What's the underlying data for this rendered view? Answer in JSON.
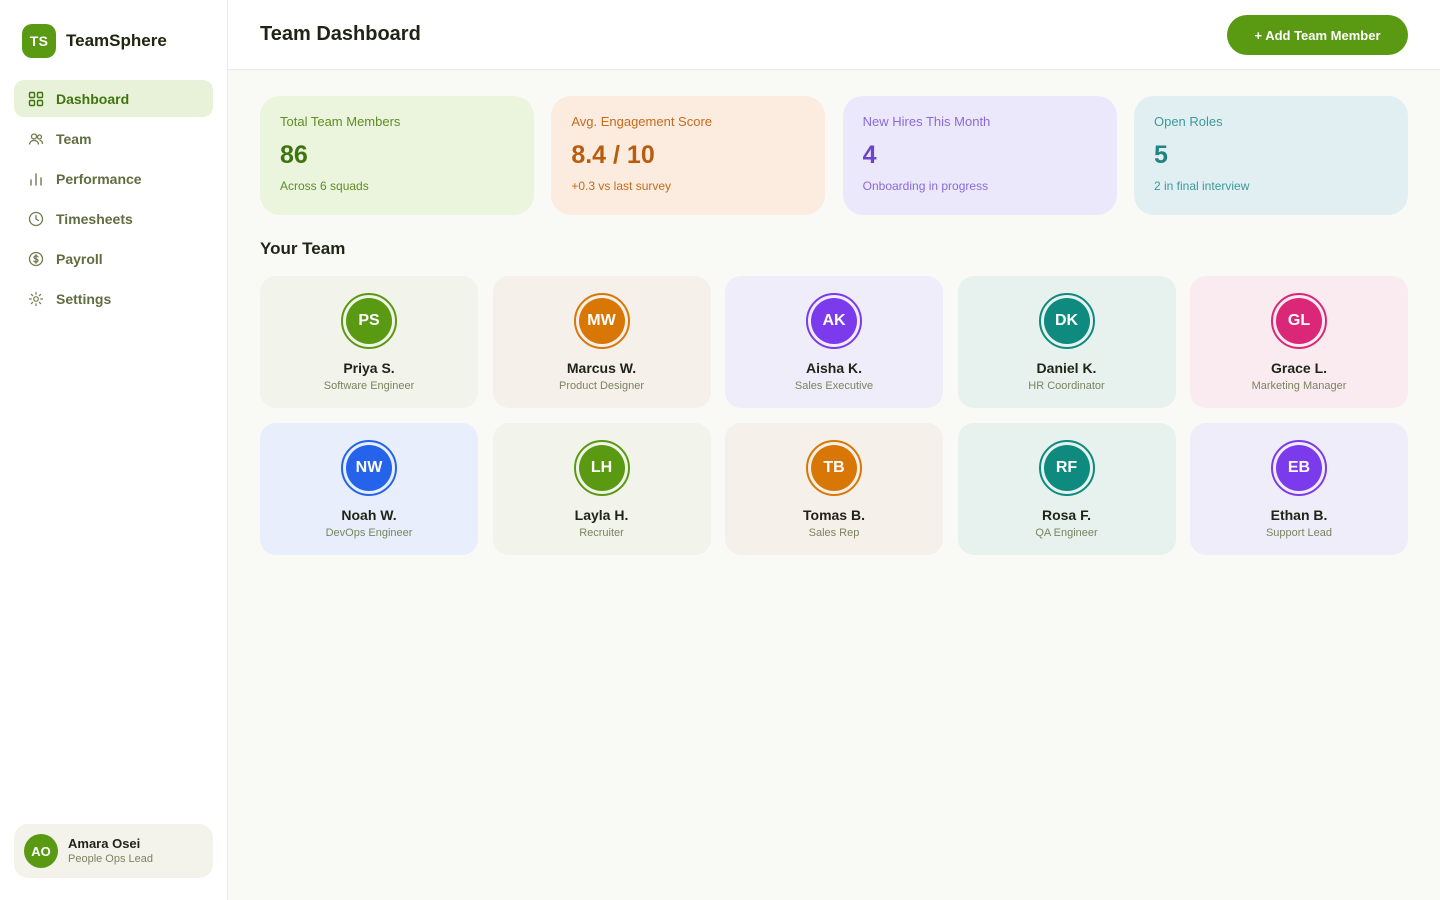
{
  "brand": {
    "initials": "TS",
    "name": "TeamSphere"
  },
  "nav": [
    {
      "label": "Dashboard",
      "icon": "grid-icon",
      "active": true
    },
    {
      "label": "Team",
      "icon": "users-icon",
      "active": false
    },
    {
      "label": "Performance",
      "icon": "bar-chart-icon",
      "active": false
    },
    {
      "label": "Timesheets",
      "icon": "clock-icon",
      "active": false
    },
    {
      "label": "Payroll",
      "icon": "dollar-icon",
      "active": false
    },
    {
      "label": "Settings",
      "icon": "gear-icon",
      "active": false
    }
  ],
  "user": {
    "initials": "AO",
    "name": "Amara Osei",
    "role": "People Ops Lead"
  },
  "header": {
    "title": "Team Dashboard",
    "add_button": "+ Add Team Member"
  },
  "stats": [
    {
      "label": "Total Team Members",
      "value": "86",
      "sub": "Across 6 squads",
      "theme": "green"
    },
    {
      "label": "Avg. Engagement Score",
      "value": "8.4 / 10",
      "sub": "+0.3 vs last survey",
      "theme": "orange"
    },
    {
      "label": "New Hires This Month",
      "value": "4",
      "sub": "Onboarding in progress",
      "theme": "purple"
    },
    {
      "label": "Open Roles",
      "value": "5",
      "sub": "2 in final interview",
      "theme": "teal"
    }
  ],
  "team_section": {
    "title": "Your Team"
  },
  "members": [
    {
      "initials": "PS",
      "name": "Priya S.",
      "role": "Software Engineer",
      "color": "#5a9a12",
      "card": "#f2f3ea"
    },
    {
      "initials": "MW",
      "name": "Marcus W.",
      "role": "Product Designer",
      "color": "#d97706",
      "card": "#f6f0ea"
    },
    {
      "initials": "AK",
      "name": "Aisha K.",
      "role": "Sales Executive",
      "color": "#7c3aed",
      "card": "#efedf9"
    },
    {
      "initials": "DK",
      "name": "Daniel K.",
      "role": "HR Coordinator",
      "color": "#0f8a7e",
      "card": "#e7f1ee"
    },
    {
      "initials": "GL",
      "name": "Grace L.",
      "role": "Marketing Manager",
      "color": "#db2777",
      "card": "#f9ebef"
    },
    {
      "initials": "NW",
      "name": "Noah W.",
      "role": "DevOps Engineer",
      "color": "#2563eb",
      "card": "#e8eefb"
    },
    {
      "initials": "LH",
      "name": "Layla H.",
      "role": "Recruiter",
      "color": "#5a9a12",
      "card": "#f2f3ea"
    },
    {
      "initials": "TB",
      "name": "Tomas B.",
      "role": "Sales Rep",
      "color": "#d97706",
      "card": "#f6f0ea"
    },
    {
      "initials": "RF",
      "name": "Rosa F.",
      "role": "QA Engineer",
      "color": "#0f8a7e",
      "card": "#e7f1ee"
    },
    {
      "initials": "EB",
      "name": "Ethan B.",
      "role": "Support Lead",
      "color": "#7c3aed",
      "card": "#efedf9"
    }
  ],
  "colors": {
    "accent": "#5a9a12",
    "accent_soft": "#e8f2d8"
  }
}
